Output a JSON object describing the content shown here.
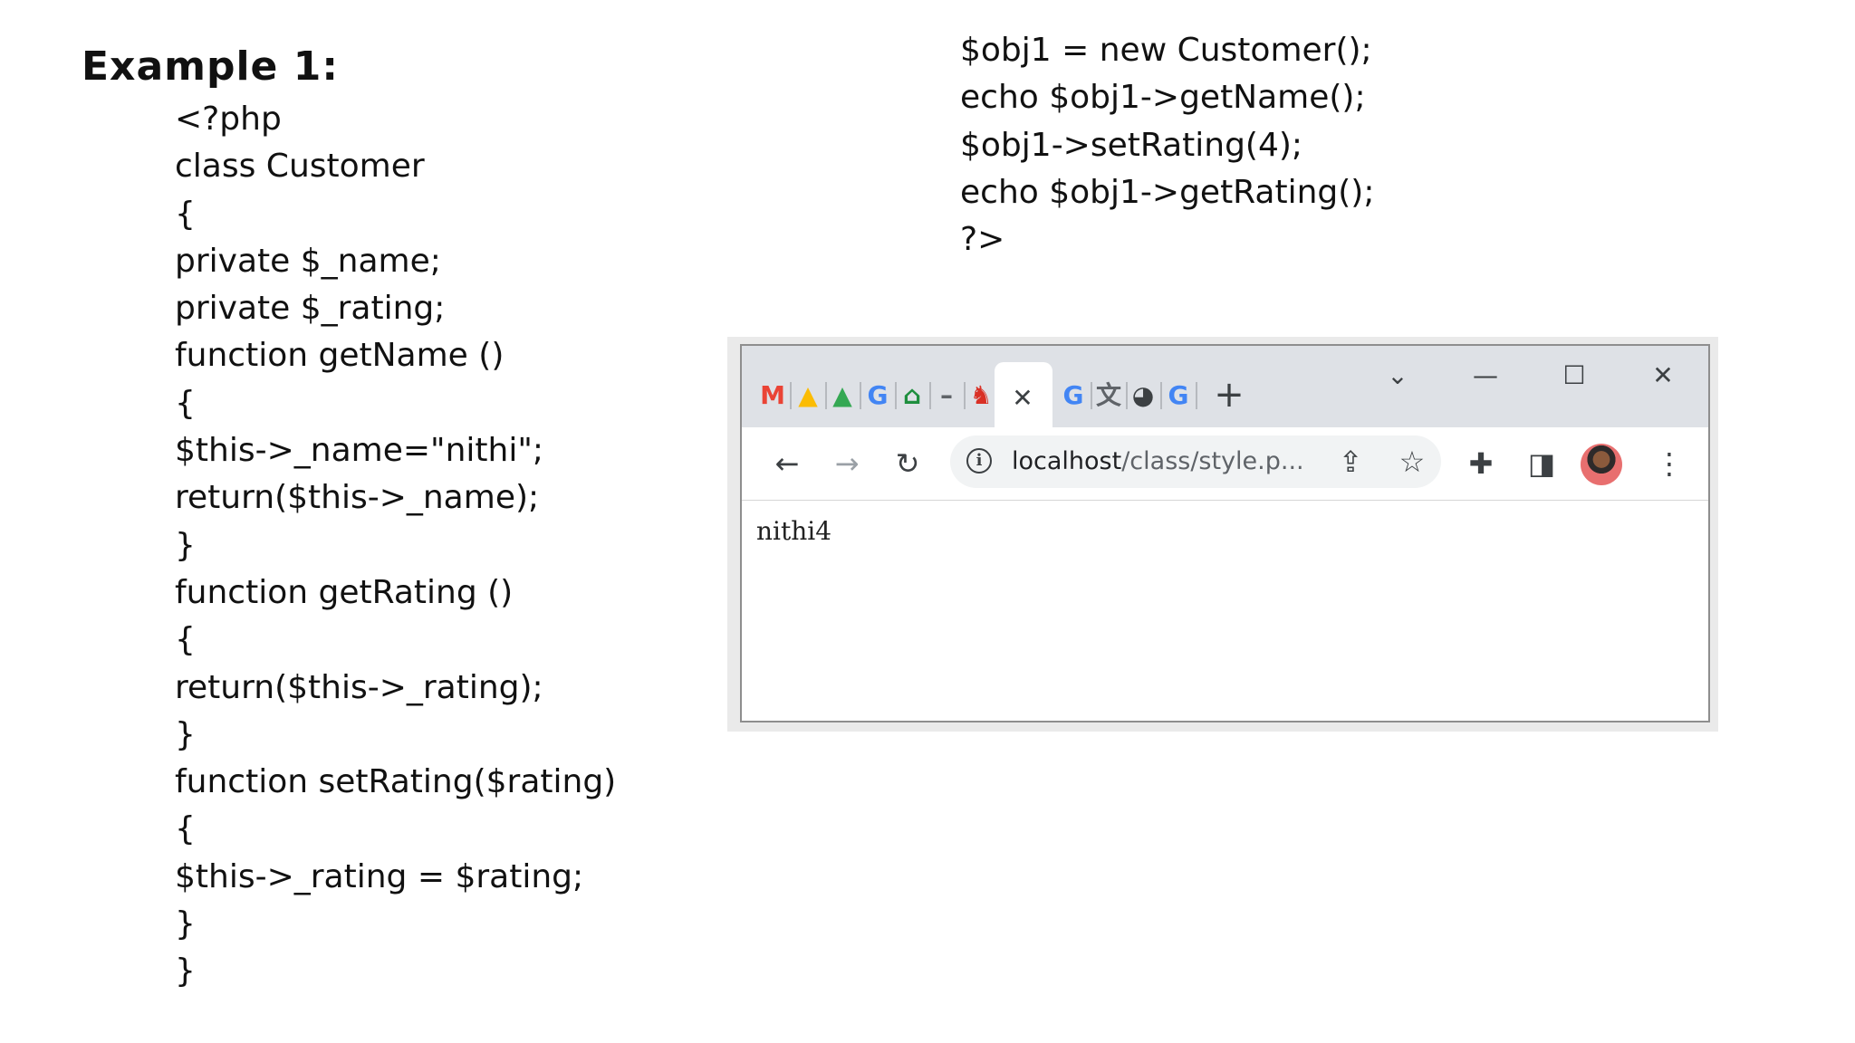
{
  "slide": {
    "title": "Example 1:",
    "code_left": [
      "<?php",
      "class Customer",
      "{",
      "private $_name;",
      "private $_rating;",
      "function getName ()",
      "{",
      "$this->_name=\"nithi\";",
      "return($this->_name);",
      "}",
      "function getRating ()",
      "{",
      "return($this->_rating);",
      "}",
      "function setRating($rating)",
      "{",
      "$this->_rating = $rating;",
      "}",
      "}"
    ],
    "code_right": [
      "$obj1 = new Customer();",
      "echo $obj1->getName();",
      "$obj1->setRating(4);",
      "echo $obj1->getRating();",
      "?>"
    ]
  },
  "browser": {
    "favicons": [
      {
        "name": "gmail-favicon",
        "glyph": "M",
        "color": "#ea4335"
      },
      {
        "name": "drive-favicon",
        "glyph": "▲",
        "color": "#fbbc04"
      },
      {
        "name": "drive-favicon-2",
        "glyph": "▲",
        "color": "#34a853"
      },
      {
        "name": "google-favicon",
        "glyph": "G",
        "color": "#4285f4"
      },
      {
        "name": "classroom-favicon",
        "glyph": "⌂",
        "color": "#1e8e3e"
      },
      {
        "name": "minimize-favicon",
        "glyph": "–",
        "color": "#5f6368"
      },
      {
        "name": "red-figure-favicon",
        "glyph": "♞",
        "color": "#d93025"
      }
    ],
    "favicons_after": [
      {
        "name": "google-favicon-2",
        "glyph": "G",
        "color": "#4285f4"
      },
      {
        "name": "translate-favicon",
        "glyph": "文",
        "color": "#5f6368"
      },
      {
        "name": "globe-favicon",
        "glyph": "◕",
        "color": "#3c4043"
      },
      {
        "name": "google-favicon-3",
        "glyph": "G",
        "color": "#4285f4"
      }
    ],
    "tab_close_glyph": "✕",
    "new_tab_glyph": "+",
    "window": {
      "menu_glyph": "⌄",
      "minimize_glyph": "—",
      "maximize_glyph": "☐",
      "close_glyph": "✕"
    },
    "nav": {
      "back_glyph": "←",
      "forward_glyph": "→",
      "reload_glyph": "↻",
      "share_glyph": "⇪",
      "star_glyph": "☆",
      "extensions_glyph": "✚",
      "sidepanel_glyph": "◨",
      "menu_glyph": "⋮"
    },
    "address": {
      "info_glyph": "i",
      "host": "localhost",
      "path": "/class/style.p..."
    },
    "page_output": "nithi4"
  }
}
